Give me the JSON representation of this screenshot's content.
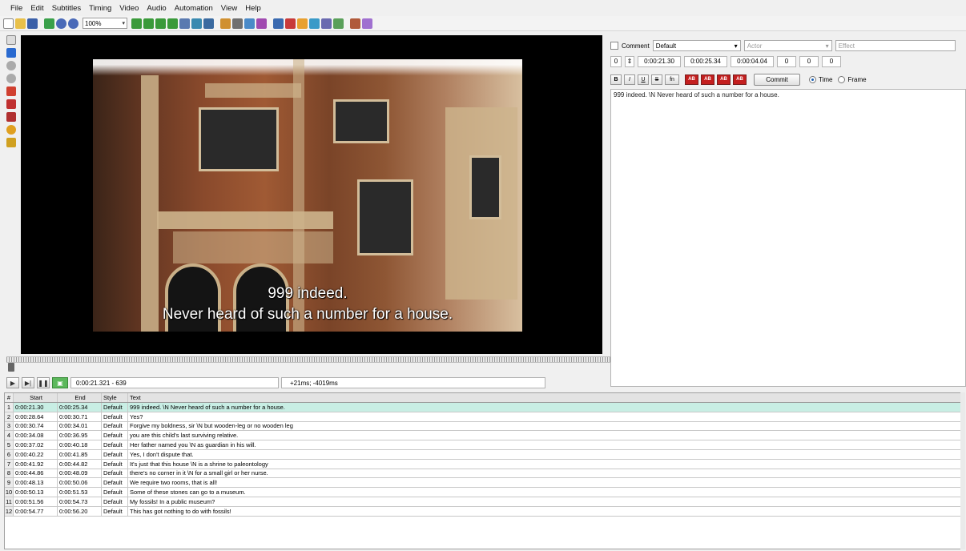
{
  "menu": [
    "File",
    "Edit",
    "Subtitles",
    "Timing",
    "Video",
    "Audio",
    "Automation",
    "View",
    "Help"
  ],
  "toolbar": {
    "zoom": "100%",
    "icons": [
      "new-icon",
      "open-icon",
      "save-icon",
      "jump-icon",
      "zoom-in-icon",
      "zoom-out-icon",
      "style-icon",
      "properties-icon",
      "attachments-icon",
      "fonts-icon",
      "spellcheck-icon",
      "translation-icon",
      "resample-icon",
      "timing-post-icon",
      "kanji-timer-icon",
      "styling-icon",
      "select-lines-icon",
      "shift-times-icon",
      "automation-icon",
      "options-icon",
      "help-icon"
    ]
  },
  "video": {
    "subtitle_line1": "999 indeed.",
    "subtitle_line2": "Never heard of such a number for a house.",
    "position": "0:00:21.321 - 639",
    "offset": "+21ms; -4019ms"
  },
  "edit": {
    "comment_label": "Comment",
    "style": "Default",
    "actor_placeholder": "Actor",
    "effect_placeholder": "Effect",
    "layer": "0",
    "start": "0:00:21.30",
    "end": "0:00:25.34",
    "duration": "0:00:04.04",
    "margin_l": "0",
    "margin_r": "0",
    "margin_v": "0",
    "format_buttons": [
      "B",
      "I",
      "U",
      "S",
      "fn"
    ],
    "color_buttons": [
      "AB",
      "AB",
      "AB",
      "AB"
    ],
    "commit_label": "Commit",
    "time_label": "Time",
    "frame_label": "Frame",
    "text": "999 indeed. \\N Never heard of such a number for a house."
  },
  "grid": {
    "headers": [
      "#",
      "Start",
      "End",
      "Style",
      "Text"
    ],
    "rows": [
      {
        "n": "1",
        "start": "0:00:21.30",
        "end": "0:00:25.34",
        "style": "Default",
        "text": "999 indeed. \\N Never heard of such a number for a house."
      },
      {
        "n": "2",
        "start": "0:00:28.64",
        "end": "0:00:30.71",
        "style": "Default",
        "text": "Yes?"
      },
      {
        "n": "3",
        "start": "0:00:30.74",
        "end": "0:00:34.01",
        "style": "Default",
        "text": "Forgive my boldness, sir \\N but wooden-leg or no wooden leg"
      },
      {
        "n": "4",
        "start": "0:00:34.08",
        "end": "0:00:36.95",
        "style": "Default",
        "text": "you are this child's last surviving relative."
      },
      {
        "n": "5",
        "start": "0:00:37.02",
        "end": "0:00:40.18",
        "style": "Default",
        "text": "Her father named you \\N as guardian in his will."
      },
      {
        "n": "6",
        "start": "0:00:40.22",
        "end": "0:00:41.85",
        "style": "Default",
        "text": "Yes, I don't dispute that."
      },
      {
        "n": "7",
        "start": "0:00:41.92",
        "end": "0:00:44.82",
        "style": "Default",
        "text": "It's just that this house \\N is a shrine to paleontology"
      },
      {
        "n": "8",
        "start": "0:00:44.86",
        "end": "0:00:48.09",
        "style": "Default",
        "text": "there's no corner in it \\N for a small girl or her nurse."
      },
      {
        "n": "9",
        "start": "0:00:48.13",
        "end": "0:00:50.06",
        "style": "Default",
        "text": "We require two rooms, that is all!"
      },
      {
        "n": "10",
        "start": "0:00:50.13",
        "end": "0:00:51.53",
        "style": "Default",
        "text": "Some of these stones can go to a museum."
      },
      {
        "n": "11",
        "start": "0:00:51.56",
        "end": "0:00:54.73",
        "style": "Default",
        "text": "My fossils! In a public museum?"
      },
      {
        "n": "12",
        "start": "0:00:54.77",
        "end": "0:00:56.20",
        "style": "Default",
        "text": "This has got nothing to do with fossils!"
      }
    ]
  },
  "colors": {
    "selected_row": "#c8eee4",
    "accent_green": "#5cb85c",
    "color_button_red": "#c41f1f"
  }
}
